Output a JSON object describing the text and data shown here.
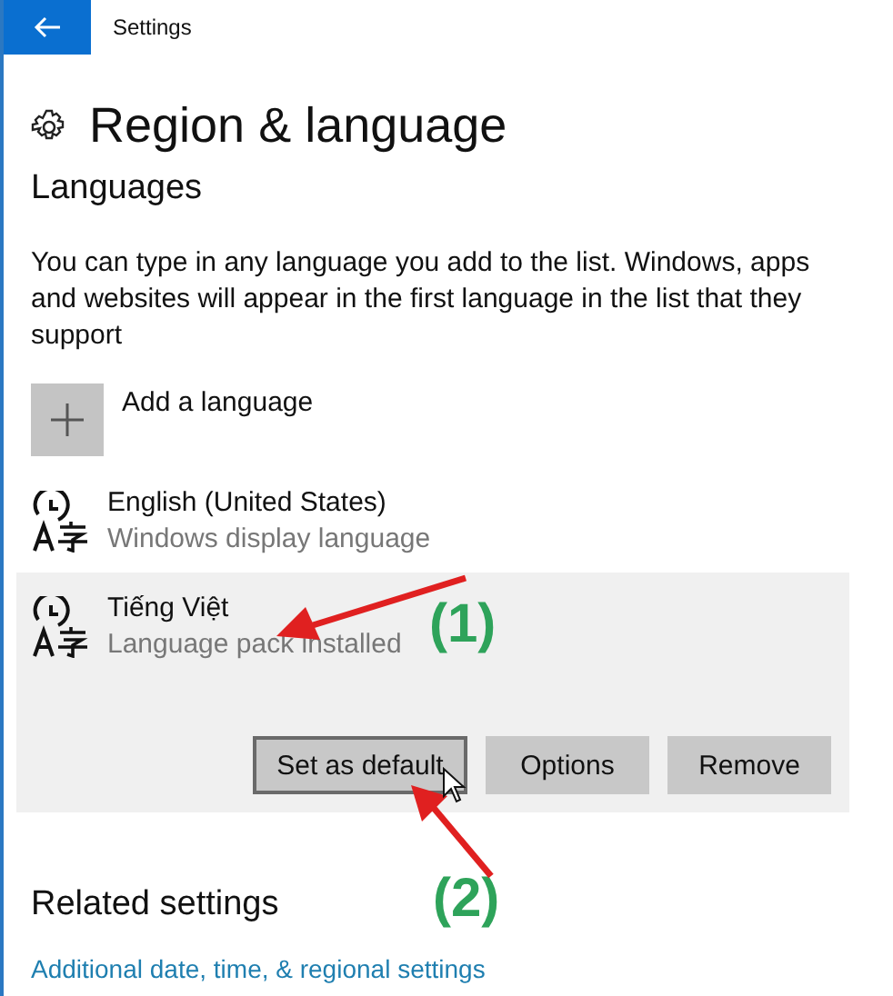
{
  "window": {
    "title": "Settings"
  },
  "page": {
    "title": "Region & language"
  },
  "languages": {
    "heading": "Languages",
    "description": "You can type in any language you add to the list. Windows, apps and websites will appear in the first language in the list that they support",
    "add_label": "Add a language",
    "items": [
      {
        "name": "English (United States)",
        "status": "Windows display language",
        "selected": false
      },
      {
        "name": "Tiếng Việt",
        "status": "Language pack installed",
        "selected": true
      }
    ],
    "buttons": [
      {
        "label": "Set as default",
        "focused": true
      },
      {
        "label": "Options",
        "focused": false
      },
      {
        "label": "Remove",
        "focused": false
      }
    ]
  },
  "related": {
    "heading": "Related settings",
    "link": "Additional date, time, & regional settings"
  },
  "annotations": [
    {
      "label": "(1)"
    },
    {
      "label": "(2)"
    }
  ]
}
